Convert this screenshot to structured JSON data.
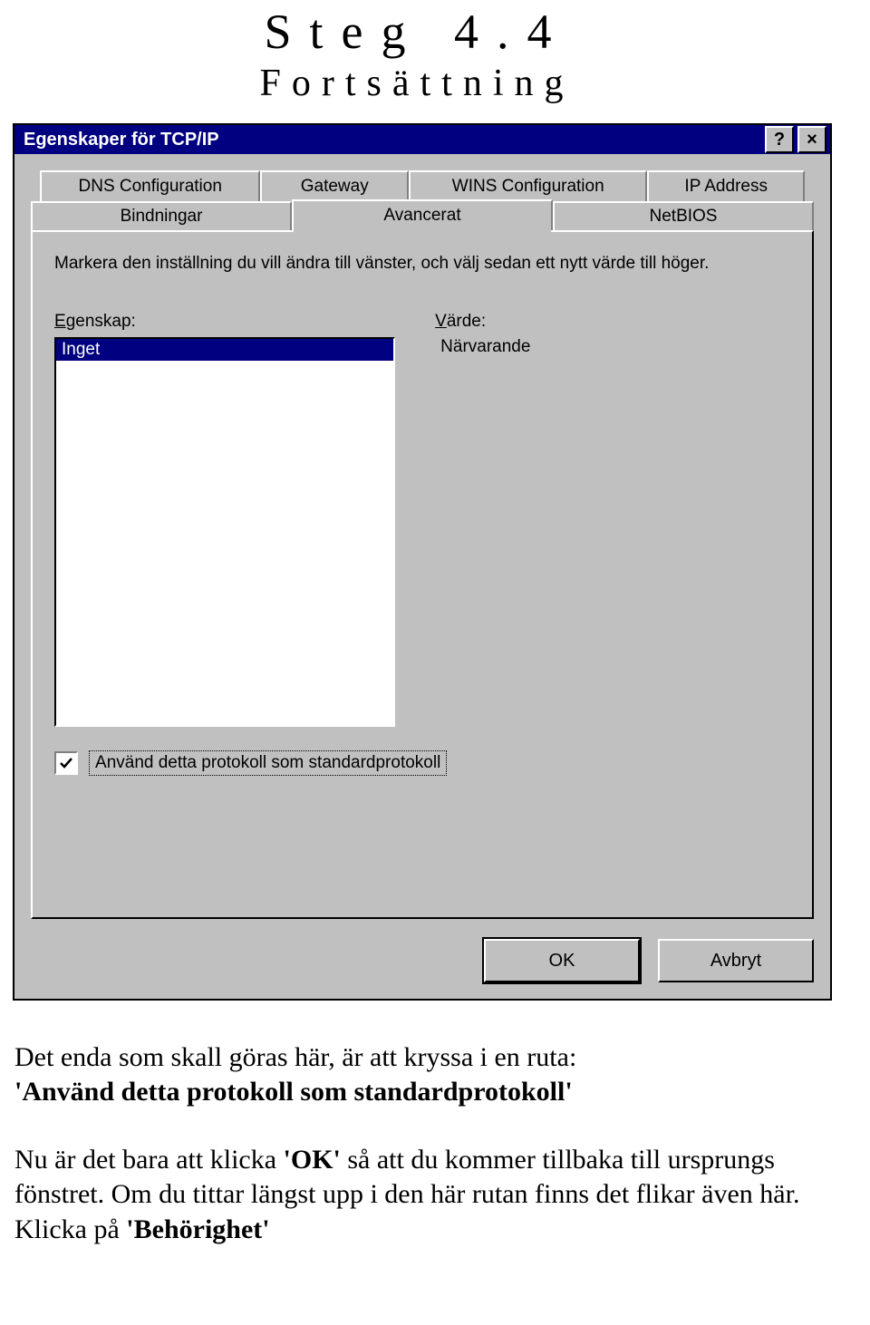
{
  "heading": {
    "title": "Steg 4.4",
    "subtitle": "Fortsättning"
  },
  "window": {
    "title": "Egenskaper för TCP/IP",
    "help": "?",
    "close": "×",
    "tabs_back": [
      "DNS Configuration",
      "Gateway",
      "WINS Configuration",
      "IP Address"
    ],
    "tabs_front": [
      "Bindningar",
      "Avancerat",
      "NetBIOS"
    ],
    "instruction": "Markera den inställning du vill ändra till vänster, och välj sedan ett nytt värde till höger.",
    "labels": {
      "egenskap_u": "E",
      "egenskap_rest": "genskap:",
      "varde_u": "V",
      "varde_rest": "ärde:"
    },
    "list_item": "Inget",
    "value_text": "Närvarande",
    "checkbox_label_u": "A",
    "checkbox_label_rest": "nvänd detta protokoll som standardprotokoll",
    "buttons": {
      "ok": "OK",
      "cancel": "Avbryt"
    }
  },
  "body": {
    "p1_a": "Det enda som skall göras här, är att kryssa i en ruta:",
    "p1_b": "'Använd detta protokoll som standardprotokoll'",
    "p2_a": "Nu är det bara att klicka ",
    "p2_ok": "'OK'",
    "p2_b": " så att du kommer tillbaka till ursprungs fönstret. Om du tittar längst upp i den här rutan finns det flikar även här. Klicka på ",
    "p2_beh": "'Behörighet'"
  }
}
